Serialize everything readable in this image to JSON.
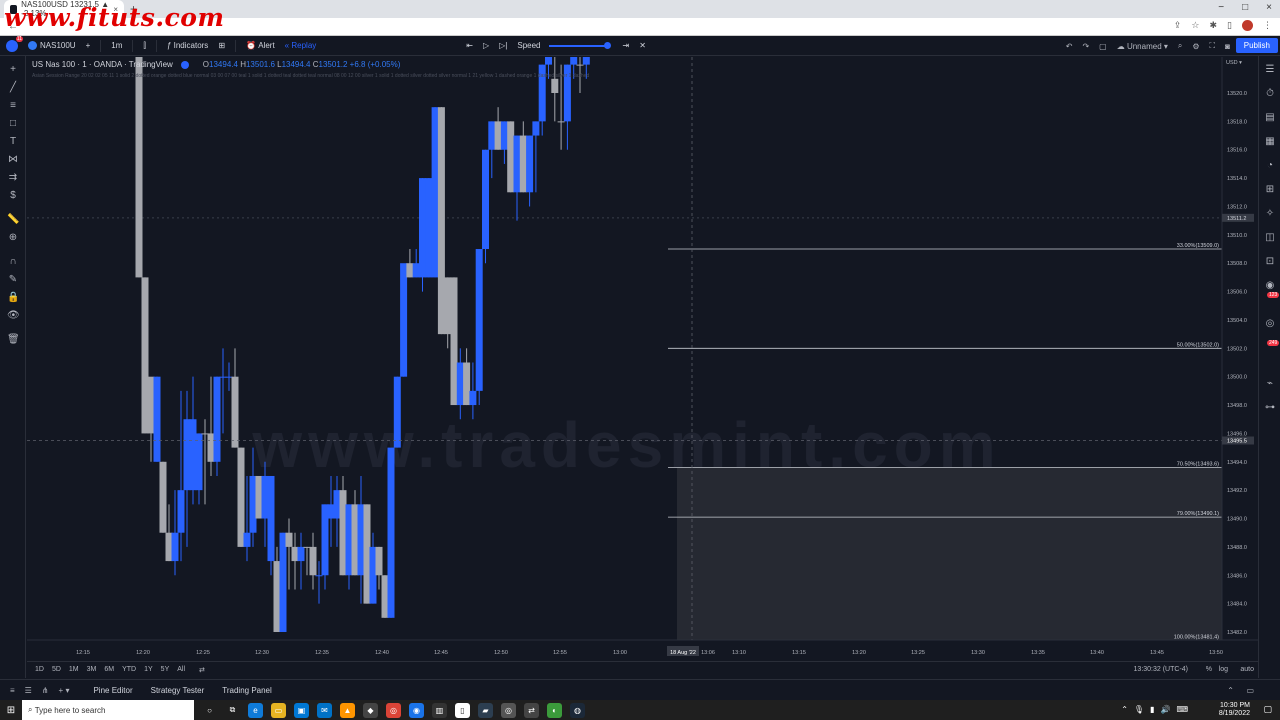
{
  "overlay": {
    "site_watermark": "www.fituts.com",
    "chart_watermark": "www.tradesmint.com"
  },
  "browser": {
    "tab_title": "NAS100USD 13231.5 ▲ -2.13%",
    "tab_close": "×",
    "new_tab": "+",
    "window_controls": [
      "−",
      "□",
      "×"
    ]
  },
  "toolbar": {
    "user_badge": "11",
    "symbol": "NAS100U",
    "add_symbol": "+",
    "interval": "1m",
    "indicators": "Indicators",
    "alert": "Alert",
    "replay": "Replay",
    "speed": "Speed",
    "layout_name": "Unnamed",
    "publish": "Publish"
  },
  "legend": {
    "title": "US Nas 100 · 1 · OANDA · TradingView",
    "open_label": "O",
    "open": "13494.4",
    "high_label": "H",
    "high": "13501.6",
    "low_label": "L",
    "low": "13494.4",
    "close_label": "C",
    "close": "13501.2",
    "change": "+6.8 (+0.05%)",
    "indicator_line": "Asian Session Range 20 02 02 05 11 1 solid 2 dotted orange dotted blue normal 03 00 07 00 teal 1 solid 1 dotted teal dotted teal normal 08 00 12 00 silver 1 solid 1 dotted silver dotted silver normal 1 21 yellow 1 dashed orange 1 dashed silver 1 dashed"
  },
  "chart_data": {
    "type": "candlestick",
    "symbol": "US Nas 100",
    "interval": "1",
    "source": "OANDA",
    "y_range": [
      13481,
      13523
    ],
    "currency": "USD",
    "x_ticks": [
      "12:15",
      "12:20",
      "12:25",
      "12:30",
      "12:35",
      "12:40",
      "12:45",
      "12:50",
      "12:55",
      "13:00",
      "13:06",
      "13:10",
      "13:15",
      "13:20",
      "13:25",
      "13:30",
      "13:35",
      "13:40",
      "13:45",
      "13:50"
    ],
    "x_date_label": "18 Aug '22",
    "y_ticks": [
      "13520.0",
      "13518.0",
      "13516.0",
      "13514.0",
      "13512.0",
      "13510.0",
      "13508.0",
      "13506.0",
      "13504.0",
      "13502.0",
      "13500.0",
      "13498.0",
      "13496.0",
      "13494.0",
      "13492.0",
      "13490.0",
      "13488.0",
      "13486.0",
      "13484.0",
      "13482.0"
    ],
    "current_price_label": "13511.2",
    "crosshair_price_label": "13495.5",
    "fib_levels": [
      {
        "label": "33.00%(13509.0)",
        "price": 13509.0
      },
      {
        "label": "50.00%(13502.0)",
        "price": 13502.0
      },
      {
        "label": "70.50%(13493.6)",
        "price": 13493.6
      },
      {
        "label": "79.00%(13490.1)",
        "price": 13490.1
      },
      {
        "label": "100.00%(13481.4)",
        "price": 13481.4
      }
    ],
    "candles": [
      [
        13528,
        13528,
        13507,
        13507,
        0
      ],
      [
        13507,
        13507,
        13496,
        13496,
        0
      ],
      [
        13496,
        13496,
        13494,
        13500,
        0
      ],
      [
        13500,
        13500,
        13494,
        13494,
        1
      ],
      [
        13494,
        13494,
        13489,
        13489,
        0
      ],
      [
        13489,
        13491,
        13487,
        13487,
        0
      ],
      [
        13487,
        13492,
        13486,
        13489,
        1
      ],
      [
        13489,
        13499,
        13487,
        13492,
        1
      ],
      [
        13492,
        13499,
        13488,
        13497,
        1
      ],
      [
        13497,
        13500,
        13491,
        13492,
        1
      ],
      [
        13492,
        13496,
        13491,
        13496,
        1
      ],
      [
        13496,
        13497,
        13491,
        13496,
        0
      ],
      [
        13496,
        13500,
        13493,
        13494,
        0
      ],
      [
        13494,
        13500,
        13493,
        13500,
        1
      ],
      [
        13500,
        13502,
        13496,
        13500,
        1
      ],
      [
        13500,
        13501,
        13499,
        13500,
        1
      ],
      [
        13500,
        13502,
        13495,
        13495,
        0
      ],
      [
        13495,
        13495,
        13488,
        13488,
        0
      ],
      [
        13488,
        13493,
        13487,
        13489,
        1
      ],
      [
        13489,
        13495,
        13488,
        13493,
        1
      ],
      [
        13493,
        13493,
        13490,
        13490,
        0
      ],
      [
        13490,
        13494,
        13488,
        13493,
        1
      ],
      [
        13493,
        13493,
        13486,
        13487,
        1
      ],
      [
        13487,
        13488,
        13482,
        13482,
        0
      ],
      [
        13482,
        13489,
        13482,
        13489,
        1
      ],
      [
        13489,
        13490,
        13485,
        13488,
        0
      ],
      [
        13488,
        13489,
        13485,
        13487,
        0
      ],
      [
        13487,
        13489,
        13485,
        13488,
        1
      ],
      [
        13488,
        13488,
        13486,
        13488,
        0
      ],
      [
        13488,
        13489,
        13485,
        13486,
        0
      ],
      [
        13486,
        13487,
        13484,
        13486,
        1
      ],
      [
        13486,
        13491,
        13485,
        13491,
        1
      ],
      [
        13491,
        13493,
        13488,
        13490,
        1
      ],
      [
        13490,
        13493,
        13488,
        13492,
        1
      ],
      [
        13492,
        13493,
        13486,
        13486,
        0
      ],
      [
        13486,
        13491,
        13485,
        13491,
        1
      ],
      [
        13491,
        13492,
        13486,
        13486,
        0
      ],
      [
        13486,
        13493,
        13484,
        13491,
        1
      ],
      [
        13491,
        13491,
        13484,
        13484,
        0
      ],
      [
        13484,
        13489,
        13484,
        13488,
        1
      ],
      [
        13488,
        13488,
        13485,
        13486,
        0
      ],
      [
        13486,
        13486,
        13483,
        13483,
        0
      ],
      [
        13483,
        13484,
        13483,
        13495,
        1
      ],
      [
        13495,
        13500,
        13495,
        13500,
        1
      ],
      [
        13500,
        13504,
        13500,
        13508,
        1
      ],
      [
        13508,
        13509,
        13507,
        13507,
        0
      ],
      [
        13508,
        13509,
        13507,
        13507,
        1
      ],
      [
        13507,
        13514,
        13506,
        13514,
        1
      ],
      [
        13514,
        13514,
        13507,
        13507,
        1
      ],
      [
        13507,
        13519,
        13507,
        13519,
        1
      ],
      [
        13519,
        13519,
        13503,
        13503,
        0
      ],
      [
        13503,
        13507,
        13502,
        13507,
        0
      ],
      [
        13507,
        13507,
        13498,
        13498,
        0
      ],
      [
        13498,
        13502,
        13497,
        13501,
        1
      ],
      [
        13501,
        13502,
        13498,
        13498,
        0
      ],
      [
        13498,
        13501,
        13497,
        13499,
        1
      ],
      [
        13499,
        13509,
        13498,
        13509,
        1
      ],
      [
        13509,
        13516,
        13508,
        13516,
        1
      ],
      [
        13516,
        13518,
        13514,
        13518,
        1
      ],
      [
        13518,
        13519,
        13516,
        13516,
        0
      ],
      [
        13516,
        13518,
        13515,
        13518,
        1
      ],
      [
        13518,
        13518,
        13513,
        13513,
        0
      ],
      [
        13513,
        13517,
        13511,
        13517,
        1
      ],
      [
        13517,
        13518,
        13513,
        13513,
        0
      ],
      [
        13513,
        13517,
        13512,
        13517,
        1
      ],
      [
        13517,
        13518,
        13513,
        13518,
        1
      ],
      [
        13518,
        13522,
        13517,
        13522,
        1
      ],
      [
        13522,
        13526,
        13521,
        13526,
        1
      ],
      [
        13520,
        13523,
        13518,
        13521,
        0
      ],
      [
        13518,
        13522,
        13516,
        13518,
        0
      ],
      [
        13518,
        13522,
        13516,
        13522,
        1
      ],
      [
        13522,
        13526,
        13521,
        13526,
        1
      ],
      [
        13522,
        13526,
        13520,
        13522,
        0
      ],
      [
        13522,
        13526,
        13521,
        13526,
        1
      ]
    ]
  },
  "timeframe_bar": {
    "ranges": [
      "1D",
      "5D",
      "1M",
      "3M",
      "6M",
      "YTD",
      "1Y",
      "5Y",
      "All"
    ],
    "clock": "13:30:32 (UTC-4)",
    "percent": "%",
    "log": "log",
    "auto": "auto"
  },
  "panels": {
    "tabs": [
      "Pine Editor",
      "Strategy Tester",
      "Trading Panel"
    ]
  },
  "right_widgets": {
    "badge1": "123",
    "badge2": "249"
  },
  "taskbar": {
    "search_placeholder": "Type here to search",
    "time": "10:30 PM",
    "date": "8/19/2022"
  },
  "colors": {
    "up": "#2962ff",
    "down": "#a6a8ae",
    "background": "#131722",
    "fib_zone": "#2a2d35"
  }
}
